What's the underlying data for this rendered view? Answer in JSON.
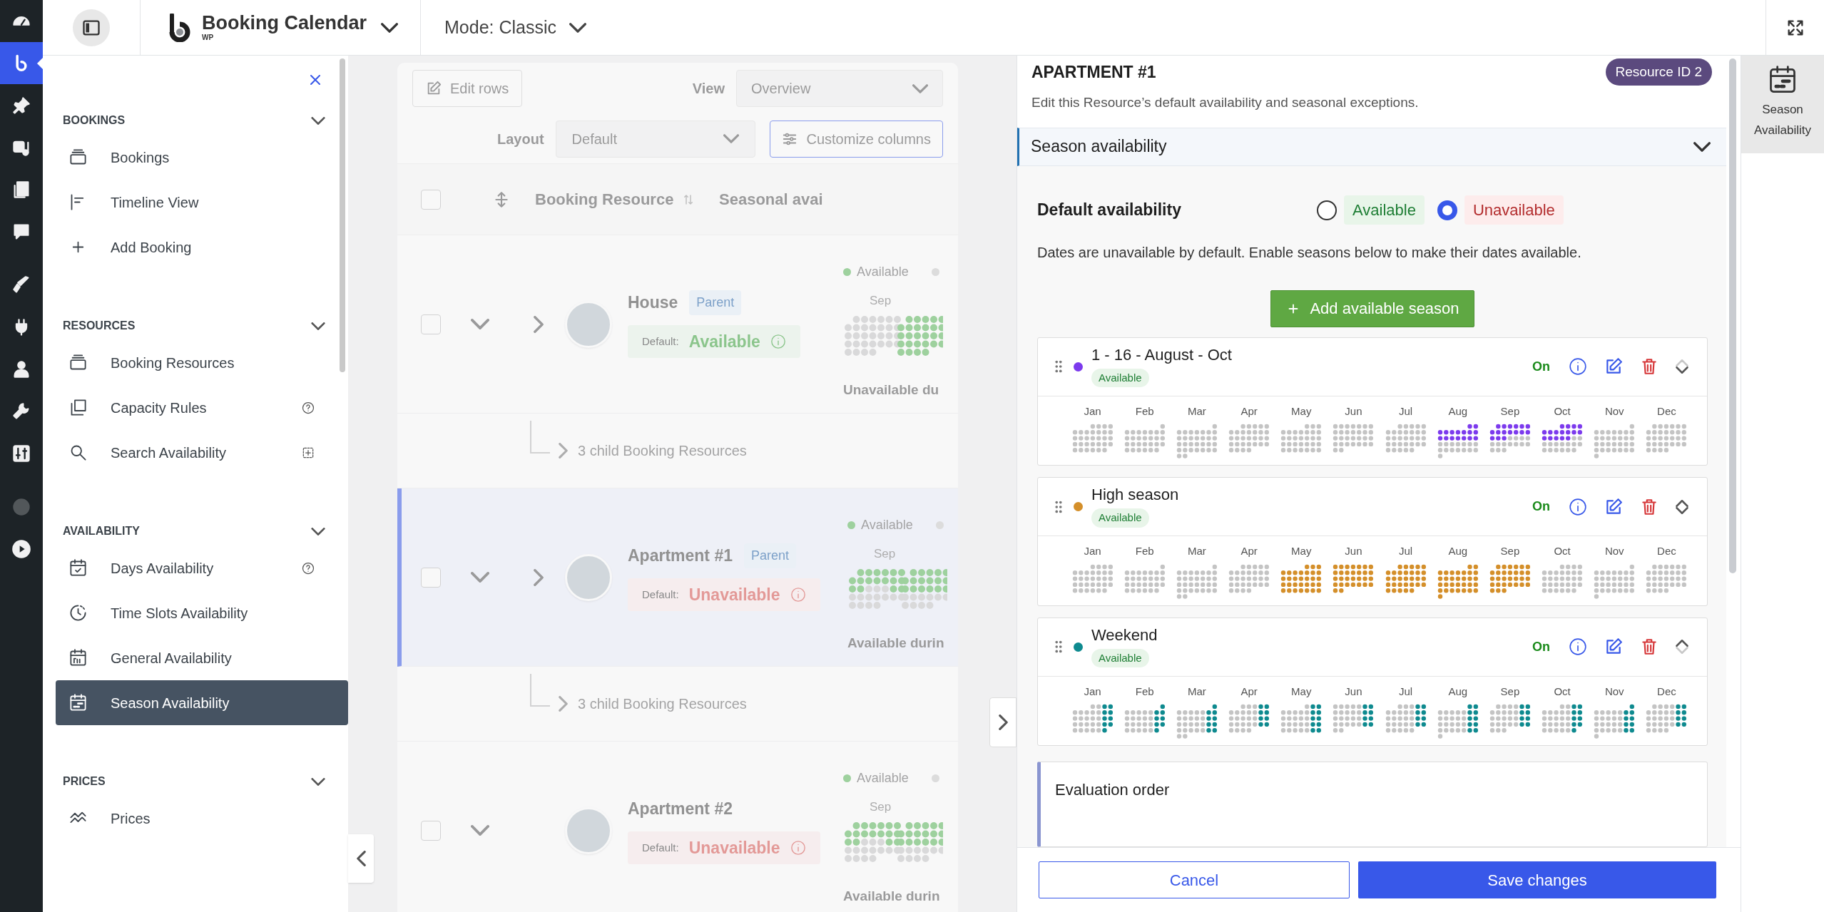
{
  "admin_menu": [
    {
      "selected": false,
      "disabled": false
    },
    {
      "selected": true,
      "disabled": false
    },
    {
      "selected": false,
      "disabled": false
    },
    {
      "selected": false,
      "disabled": false
    },
    {
      "selected": false,
      "disabled": false
    },
    {
      "selected": false,
      "disabled": false
    },
    {
      "selected": false,
      "disabled": false
    },
    {
      "selected": false,
      "disabled": false
    },
    {
      "selected": false,
      "disabled": false
    },
    {
      "selected": false,
      "disabled": false
    },
    {
      "selected": false,
      "disabled": false
    },
    {
      "selected": false,
      "disabled": true
    },
    {
      "selected": false,
      "disabled": false
    }
  ],
  "topbar": {
    "brand": "Booking Calendar",
    "brand_sub": "WP",
    "mode": "Mode: Classic"
  },
  "nav": {
    "sections": [
      {
        "title": "BOOKINGS",
        "expanded": true,
        "items": [
          {
            "label": "Bookings",
            "selected": false
          },
          {
            "label": "Timeline View",
            "selected": false
          },
          {
            "label": "Add Booking",
            "selected": false
          }
        ]
      },
      {
        "title": "RESOURCES",
        "expanded": true,
        "items": [
          {
            "label": "Booking Resources",
            "selected": false
          },
          {
            "label": "Capacity Rules",
            "selected": false
          },
          {
            "label": "Search Availability",
            "selected": false
          }
        ]
      },
      {
        "title": "AVAILABILITY",
        "expanded": true,
        "items": [
          {
            "label": "Days Availability",
            "selected": false
          },
          {
            "label": "Time Slots Availability",
            "selected": false
          },
          {
            "label": "General Availability",
            "selected": false
          },
          {
            "label": "Season Availability",
            "selected": true
          }
        ]
      },
      {
        "title": "PRICES",
        "expanded": true,
        "items": [
          {
            "label": "Prices",
            "selected": false
          }
        ]
      }
    ]
  },
  "resources_table": {
    "toolbar": {
      "edit_rows": "Edit rows",
      "view_label": "View",
      "view_value": "Overview",
      "layout_label": "Layout",
      "layout_value": "Default",
      "customize": "Customize columns"
    },
    "select_all": {
      "checked": false
    },
    "columns": [
      "Booking Resource",
      "Seasonal avai"
    ],
    "rows": [
      {
        "name": "House",
        "badge": "Parent",
        "default_label": "Default:",
        "default_value": "Available",
        "available": true,
        "legend": "Available",
        "month": "Sep",
        "summary": "Unavailable du",
        "selected": false,
        "checked": false,
        "child_summary": "3 child Booking Resources"
      },
      {
        "name": "Apartment #1",
        "badge": "Parent",
        "default_label": "Default:",
        "default_value": "Unavailable",
        "available": false,
        "legend": "Available",
        "month": "Sep",
        "summary": "Available durin",
        "selected": true,
        "checked": false,
        "child_summary": "3 child Booking Resources"
      },
      {
        "name": "Apartment #2",
        "default_label": "Default:",
        "default_value": "Unavailable",
        "available": false,
        "legend": "Available",
        "month": "Sep",
        "summary": "Available durin",
        "selected": false,
        "checked": false
      }
    ]
  },
  "drawer": {
    "title": "APARTMENT #1",
    "resource_id": "Resource ID 2",
    "subtitle": "Edit this Resource’s default availability and seasonal exceptions.",
    "section": {
      "title": "Season availability",
      "expanded": true
    },
    "default_availability": {
      "label": "Default availability",
      "options": [
        {
          "label": "Available",
          "kind": "available",
          "selected": false
        },
        {
          "label": "Unavailable",
          "kind": "unavailable",
          "selected": true
        }
      ]
    },
    "hint": "Dates are unavailable by default. Enable seasons below to make their dates available.",
    "add_button": "Add available season",
    "seasons": [
      {
        "name": "1 - 16 - August - Oct",
        "color": "#7c3aed",
        "badge": "Available",
        "status": "On",
        "can_move_up": false,
        "can_move_down": true,
        "months": [
          {
            "label": "Jan",
            "kind": "plain"
          },
          {
            "label": "Feb",
            "kind": "plain"
          },
          {
            "label": "Mar",
            "kind": "plain"
          },
          {
            "label": "Apr",
            "kind": "plain"
          },
          {
            "label": "May",
            "kind": "plain"
          },
          {
            "label": "Jun",
            "kind": "plain"
          },
          {
            "label": "Jul",
            "kind": "plain"
          },
          {
            "label": "Aug",
            "kind": "firsthalf"
          },
          {
            "label": "Sep",
            "kind": "firsthalf"
          },
          {
            "label": "Oct",
            "kind": "firsthalf"
          },
          {
            "label": "Nov",
            "kind": "plain"
          },
          {
            "label": "Dec",
            "kind": "plain"
          }
        ]
      },
      {
        "name": "High season",
        "color": "#d48f2a",
        "badge": "Available",
        "status": "On",
        "can_move_up": true,
        "can_move_down": true,
        "months": [
          {
            "label": "Jan",
            "kind": "plain"
          },
          {
            "label": "Feb",
            "kind": "plain"
          },
          {
            "label": "Mar",
            "kind": "plain"
          },
          {
            "label": "Apr",
            "kind": "plain"
          },
          {
            "label": "May",
            "kind": "full"
          },
          {
            "label": "Jun",
            "kind": "full"
          },
          {
            "label": "Jul",
            "kind": "full"
          },
          {
            "label": "Aug",
            "kind": "full"
          },
          {
            "label": "Sep",
            "kind": "full"
          },
          {
            "label": "Oct",
            "kind": "plain"
          },
          {
            "label": "Nov",
            "kind": "plain"
          },
          {
            "label": "Dec",
            "kind": "plain"
          }
        ]
      },
      {
        "name": "Weekend",
        "color": "#0e8a8f",
        "badge": "Available",
        "status": "On",
        "can_move_up": true,
        "can_move_down": false,
        "months": [
          {
            "label": "Jan",
            "kind": "weekends"
          },
          {
            "label": "Feb",
            "kind": "weekends"
          },
          {
            "label": "Mar",
            "kind": "weekends"
          },
          {
            "label": "Apr",
            "kind": "weekends"
          },
          {
            "label": "May",
            "kind": "weekends"
          },
          {
            "label": "Jun",
            "kind": "weekends"
          },
          {
            "label": "Jul",
            "kind": "weekends"
          },
          {
            "label": "Aug",
            "kind": "weekends"
          },
          {
            "label": "Sep",
            "kind": "weekends"
          },
          {
            "label": "Oct",
            "kind": "weekends"
          },
          {
            "label": "Nov",
            "kind": "weekends"
          },
          {
            "label": "Dec",
            "kind": "weekends"
          }
        ]
      }
    ],
    "evaluation_order": "Evaluation order",
    "footer": {
      "cancel": "Cancel",
      "save": "Save changes"
    }
  },
  "rail": {
    "label": "Season Availability",
    "selected": true
  }
}
